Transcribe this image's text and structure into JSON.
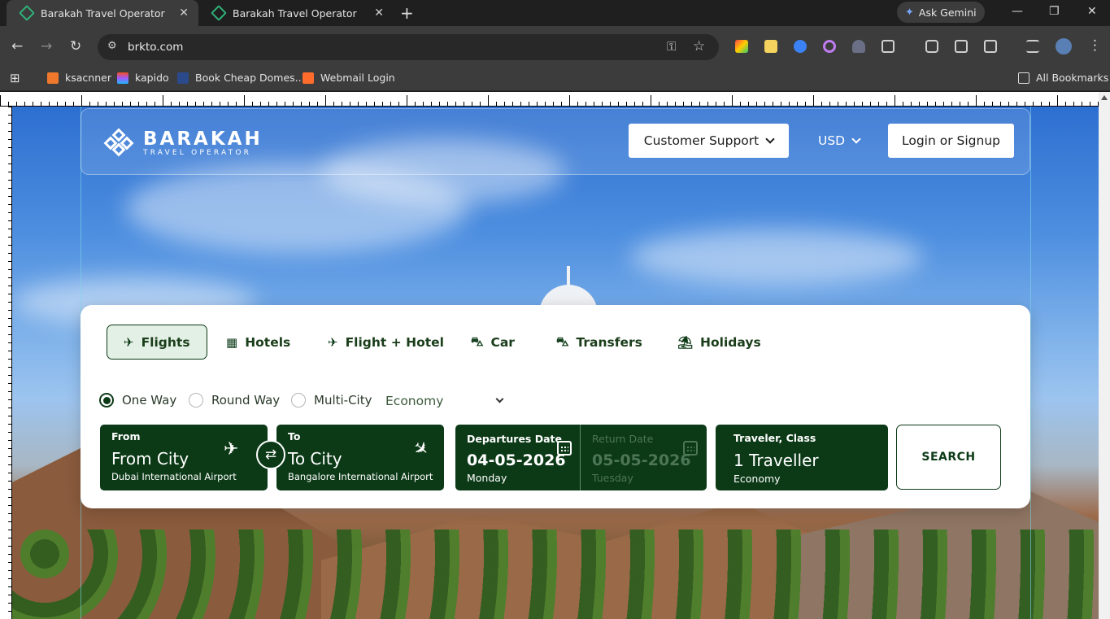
{
  "browser": {
    "tabs": [
      {
        "title": "Barakah Travel Operator",
        "active": true
      },
      {
        "title": "Barakah Travel Operator",
        "active": false
      }
    ],
    "new_tab": "+",
    "ask_gemini": "Ask Gemini",
    "url": "brkto.com",
    "bookmarks": [
      "ksacnner",
      "kapido",
      "Book Cheap Domes...",
      "Webmail Login"
    ],
    "all_bookmarks": "All Bookmarks"
  },
  "site": {
    "logo_main": "BARAKAH",
    "logo_sub": "TRAVEL OPERATOR",
    "customer_support": "Customer Support",
    "currency": "USD",
    "login": "Login or Signup"
  },
  "search": {
    "product_tabs": [
      {
        "label": "Flights",
        "icon": "plane-icon",
        "active": true
      },
      {
        "label": "Hotels",
        "icon": "hotel-icon",
        "active": false
      },
      {
        "label": "Flight + Hotel",
        "icon": "plane-icon",
        "active": false
      },
      {
        "label": "Car",
        "icon": "car-icon",
        "active": false
      },
      {
        "label": "Transfers",
        "icon": "car-icon",
        "active": false
      },
      {
        "label": "Holidays",
        "icon": "beach-icon",
        "active": false
      }
    ],
    "trip_types": [
      {
        "label": "One Way",
        "selected": true
      },
      {
        "label": "Round Way",
        "selected": false
      },
      {
        "label": "Multi-City",
        "selected": false
      }
    ],
    "cabin_class": "Economy",
    "from": {
      "label": "From",
      "value": "From City",
      "sub": "Dubai International Airport"
    },
    "to": {
      "label": "To",
      "value": "To City",
      "sub": "Bangalore International Airport"
    },
    "departure": {
      "label": "Departures Date",
      "value": "04-05-2026",
      "day": "Monday"
    },
    "return": {
      "label": "Return Date",
      "value": "05-05-2026",
      "day": "Tuesday"
    },
    "traveler": {
      "label": "Traveler, Class",
      "value": "1 Traveller",
      "sub": "Economy"
    },
    "search_button": "SEARCH"
  },
  "colors": {
    "brand_green": "#0c3a17",
    "tab_active_bg": "#e3f0e5"
  }
}
